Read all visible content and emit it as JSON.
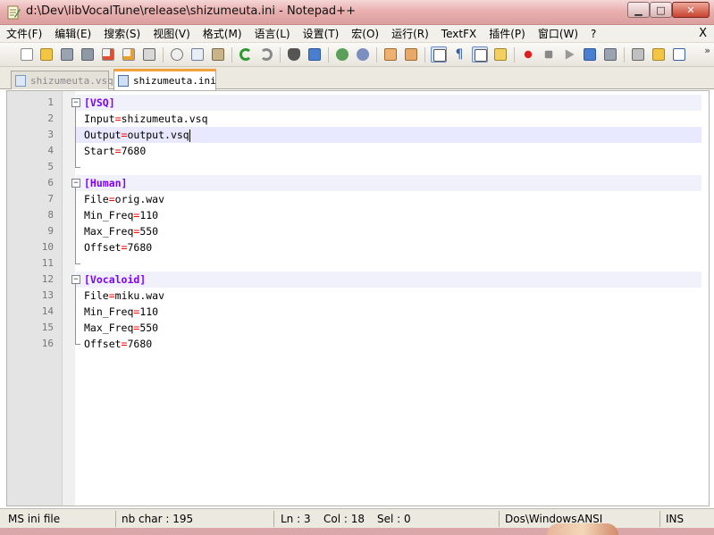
{
  "window": {
    "title": "d:\\Dev\\libVocalTune\\release\\shizumeuta.ini - Notepad++",
    "minimize_glyph": "▁",
    "maximize_glyph": "□",
    "close_glyph": "✕"
  },
  "menu": {
    "items": [
      "文件(F)",
      "编辑(E)",
      "搜索(S)",
      "视图(V)",
      "格式(M)",
      "语言(L)",
      "设置(T)",
      "宏(O)",
      "运行(R)",
      "TextFX",
      "插件(P)",
      "窗口(W)",
      "?"
    ],
    "close_glyph": "X"
  },
  "toolbar": {
    "more_glyph": "»"
  },
  "tabs": [
    {
      "label": "shizumeuta.vsq",
      "active": false
    },
    {
      "label": "shizumeuta.ini",
      "active": true
    }
  ],
  "editor": {
    "lines": [
      {
        "num": "1",
        "section": "[VSQ]"
      },
      {
        "num": "2",
        "key": "Input",
        "value": "shizumeuta.vsq"
      },
      {
        "num": "3",
        "key": "Output",
        "value": "output.vsq"
      },
      {
        "num": "4",
        "key": "Start",
        "value": "7680"
      },
      {
        "num": "5"
      },
      {
        "num": "6",
        "section": "[Human]"
      },
      {
        "num": "7",
        "key": "File",
        "value": "orig.wav"
      },
      {
        "num": "8",
        "key": "Min_Freq",
        "value": "110"
      },
      {
        "num": "9",
        "key": "Max_Freq",
        "value": "550"
      },
      {
        "num": "10",
        "key": "Offset",
        "value": "7680"
      },
      {
        "num": "11"
      },
      {
        "num": "12",
        "section": "[Vocaloid]"
      },
      {
        "num": "13",
        "key": "File",
        "value": "miku.wav"
      },
      {
        "num": "14",
        "key": "Min_Freq",
        "value": "110"
      },
      {
        "num": "15",
        "key": "Max_Freq",
        "value": "550"
      },
      {
        "num": "16",
        "key": "Offset",
        "value": "7680"
      }
    ],
    "equals": "=",
    "current_line": 3,
    "colors": {
      "section": "#8000ff",
      "operator": "#ff0000"
    }
  },
  "status": {
    "language": "MS ini file",
    "nb_char": "nb char : 195",
    "line": "Ln : 3",
    "col": "Col : 18",
    "sel": "Sel : 0",
    "eol": "Dos\\Windows",
    "encoding": "ANSI",
    "mode": "INS"
  }
}
